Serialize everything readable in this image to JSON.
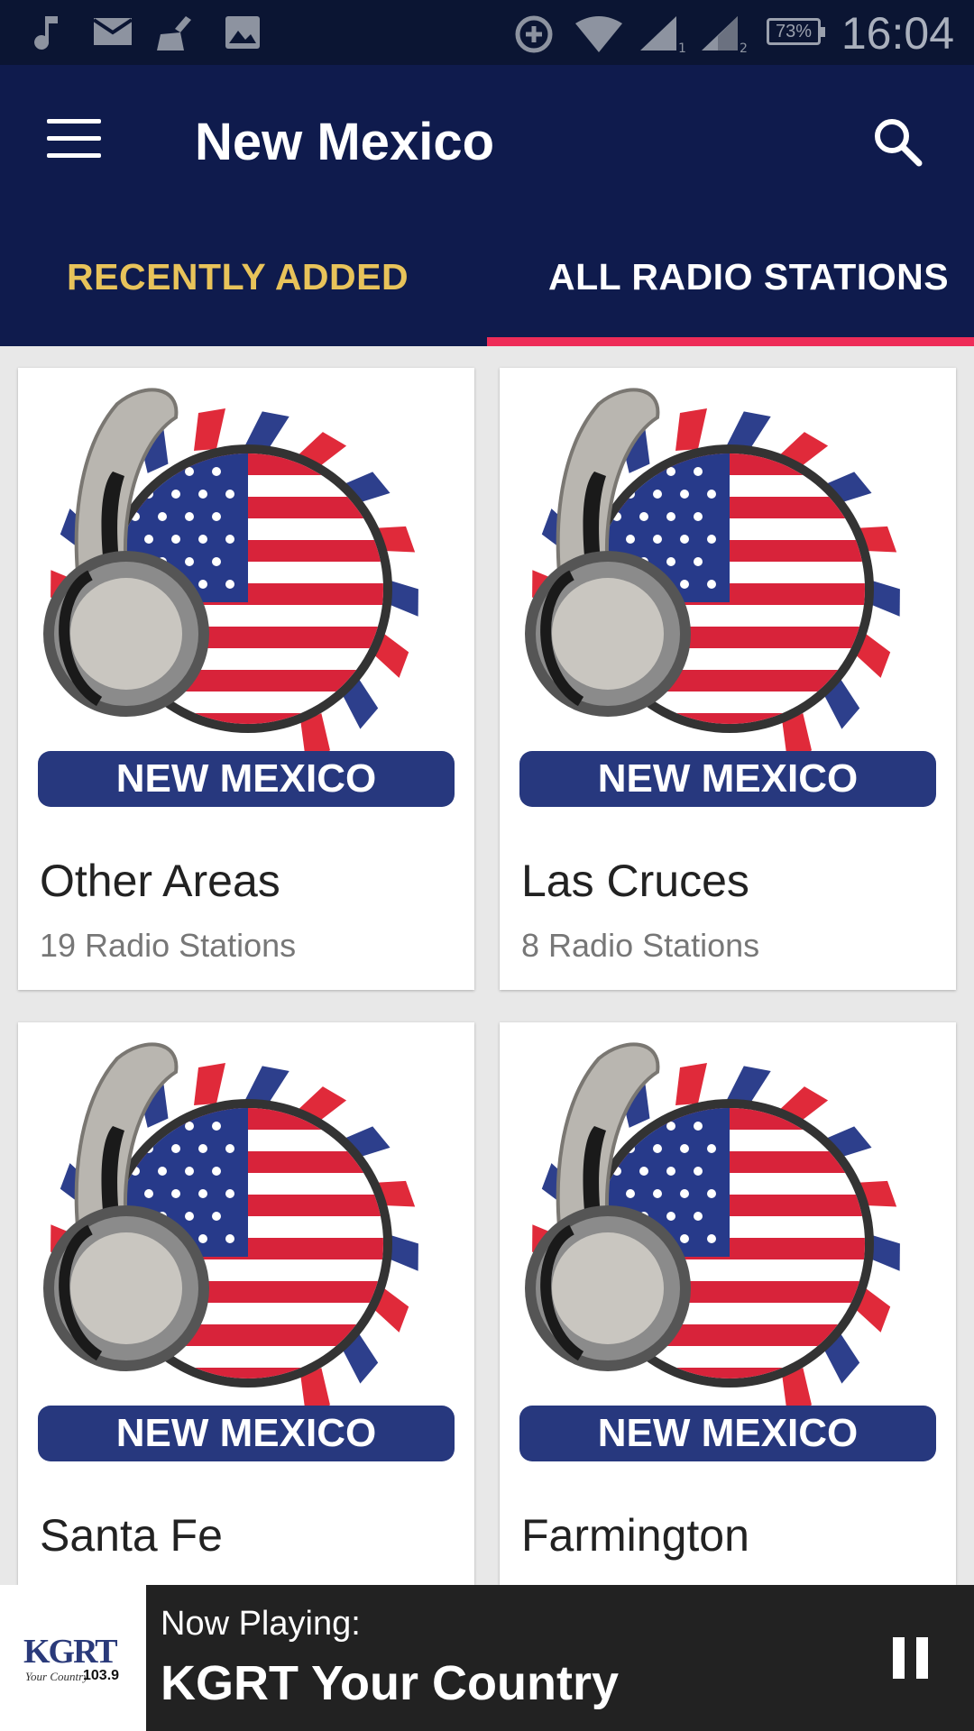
{
  "status_bar": {
    "time": "16:04",
    "battery": "73%",
    "icons": [
      "music-note-icon",
      "mail-icon",
      "broom-icon",
      "image-icon",
      "data-saver-icon",
      "wifi-icon",
      "signal-1-icon",
      "signal-2-icon"
    ]
  },
  "appbar": {
    "title": "New Mexico",
    "menu_icon": "hamburger-menu-icon",
    "search_icon": "search-icon"
  },
  "tabs": [
    {
      "label": "RECENTLY ADDED",
      "color": "#e8c35a"
    },
    {
      "label": "ALL RADIO STATIONS",
      "color": "#ffffff",
      "selected": true
    }
  ],
  "logo_text": "NEW MEXICO",
  "cards": [
    {
      "name": "Other Areas",
      "count": "19 Radio Stations"
    },
    {
      "name": "Las Cruces",
      "count": "8 Radio Stations"
    },
    {
      "name": "Santa Fe",
      "count": ""
    },
    {
      "name": "Farmington",
      "count": ""
    }
  ],
  "player": {
    "label": "Now Playing:",
    "station": "KGRT Your Country",
    "art_logo": "KGRT",
    "art_tagline": "Your Country",
    "art_freq": "103.9",
    "pause_icon": "pause-icon"
  },
  "colors": {
    "status_bar": "#0b1533",
    "appbar": "#0f1b4d",
    "tab_indicator": "#ee2c58",
    "recent_tab": "#e8c35a"
  }
}
